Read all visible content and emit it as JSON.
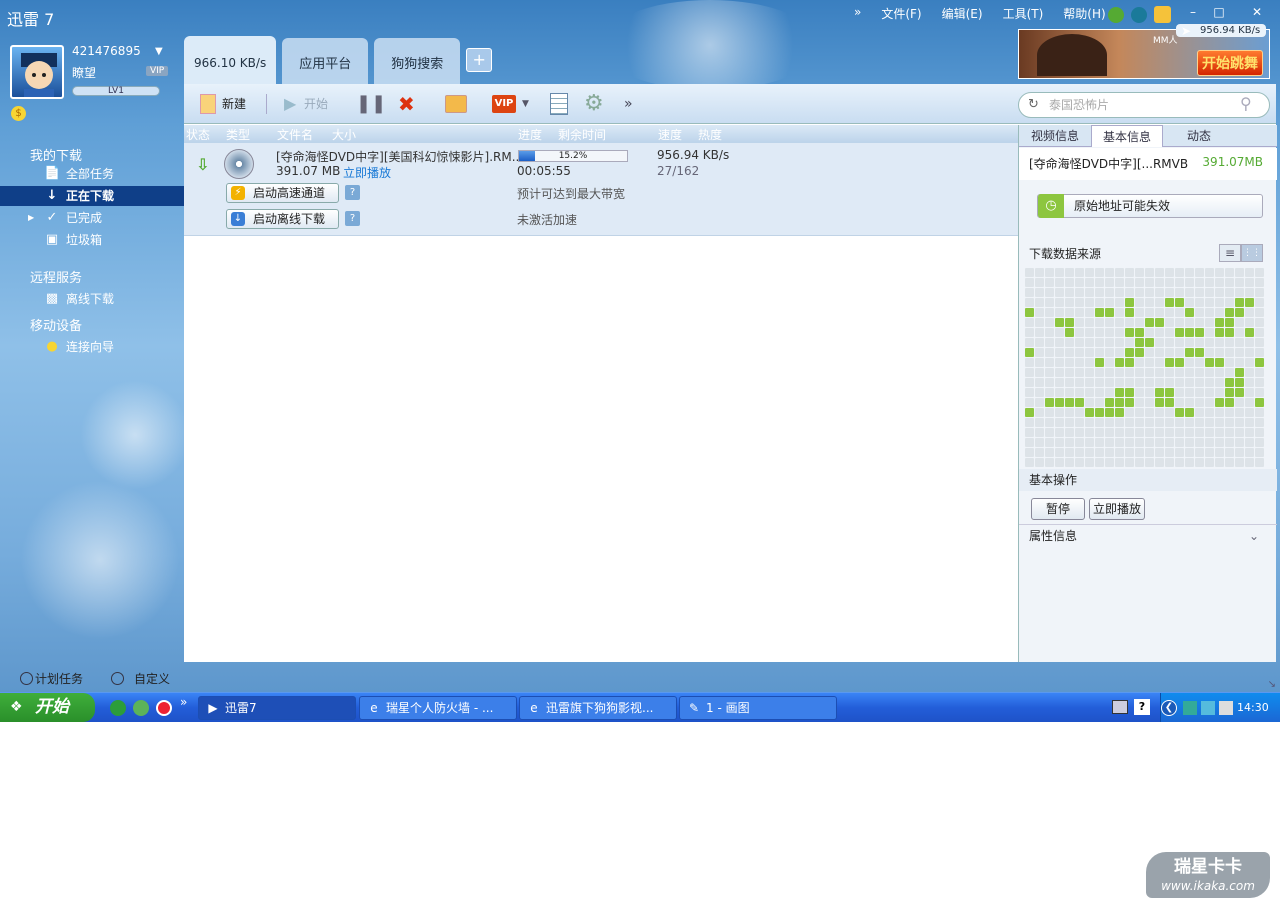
{
  "app": {
    "title": "迅雷 7"
  },
  "menu": {
    "expand": "»",
    "items": [
      "文件(F)",
      "编辑(E)",
      "工具(T)",
      "帮助(H)"
    ]
  },
  "user": {
    "id": "421476895",
    "nick": "瞭望",
    "vip": "VIP",
    "level": "LV1"
  },
  "sidebar": {
    "sections": [
      {
        "label": "我的下载"
      },
      {
        "label": "远程服务"
      },
      {
        "label": "移动设备"
      }
    ],
    "items": [
      {
        "label": "全部任务",
        "icon": "page-icon"
      },
      {
        "label": "正在下载",
        "icon": "download-arrow-icon"
      },
      {
        "label": "已完成",
        "icon": "check-icon"
      },
      {
        "label": "垃圾箱",
        "icon": "trash-icon"
      },
      {
        "label": "离线下载",
        "icon": "offline-download-icon"
      },
      {
        "label": "连接向导",
        "icon": "lightbulb-icon"
      }
    ]
  },
  "tabs": [
    {
      "label": "966.10 KB/s"
    },
    {
      "label": "应用平台"
    },
    {
      "label": "狗狗搜索"
    }
  ],
  "tab_add": "+",
  "ad": {
    "button": "开始跳舞",
    "speed": "956.94 KB/s",
    "corner": "MM人"
  },
  "toolbar": {
    "new": "新建",
    "start": "开始",
    "more": "»"
  },
  "search": {
    "placeholder": "泰国恐怖片"
  },
  "list_header": {
    "status": "状态",
    "type": "类型",
    "filename": "文件名",
    "size": "大小",
    "progress": "进度",
    "remaining": "剩余时间",
    "speed": "速度",
    "heat": "热度"
  },
  "task": {
    "filename": "[夺命海怪DVD中字][美国科幻惊悚影片].RM...",
    "size": "391.07 MB",
    "play_link": "立即播放",
    "progress_text": "15.2%",
    "progress_value": 0.152,
    "remaining": "00:05:55",
    "speed": "956.94 KB/s",
    "sources": "27/162",
    "hs_button": "启动高速通道",
    "hs_status": "预计可达到最大带宽",
    "offline_button": "启动离线下载",
    "offline_status": "未激活加速",
    "help": "?"
  },
  "rpanel": {
    "tabs": [
      "视频信息",
      "基本信息",
      "动态"
    ],
    "file_name": "[夺命海怪DVD中字][...RMVB",
    "file_size": "391.07MB",
    "warning": "原始地址可能失效",
    "sources_title": "下载数据来源",
    "ops_title": "基本操作",
    "pause": "暂停",
    "play": "立即播放",
    "props_title": "属性信息"
  },
  "bottom": {
    "scheduled": "计划任务",
    "custom": "自定义"
  },
  "taskbar": {
    "start": "开始",
    "expand": "»",
    "items": [
      {
        "label": "迅雷7"
      },
      {
        "label": "瑞星个人防火墙 - ..."
      },
      {
        "label": "迅雷旗下狗狗影视..."
      },
      {
        "label": "1 - 画图"
      }
    ],
    "clock": "14:30"
  },
  "watermark": {
    "line1": "瑞星卡卡",
    "line2": "www.ikaka.com"
  },
  "colors": {
    "accent": "#0f3f88",
    "grid_on": "#8dc63f",
    "grid_off": "#dde3e8",
    "progress": "#2f73d6"
  }
}
